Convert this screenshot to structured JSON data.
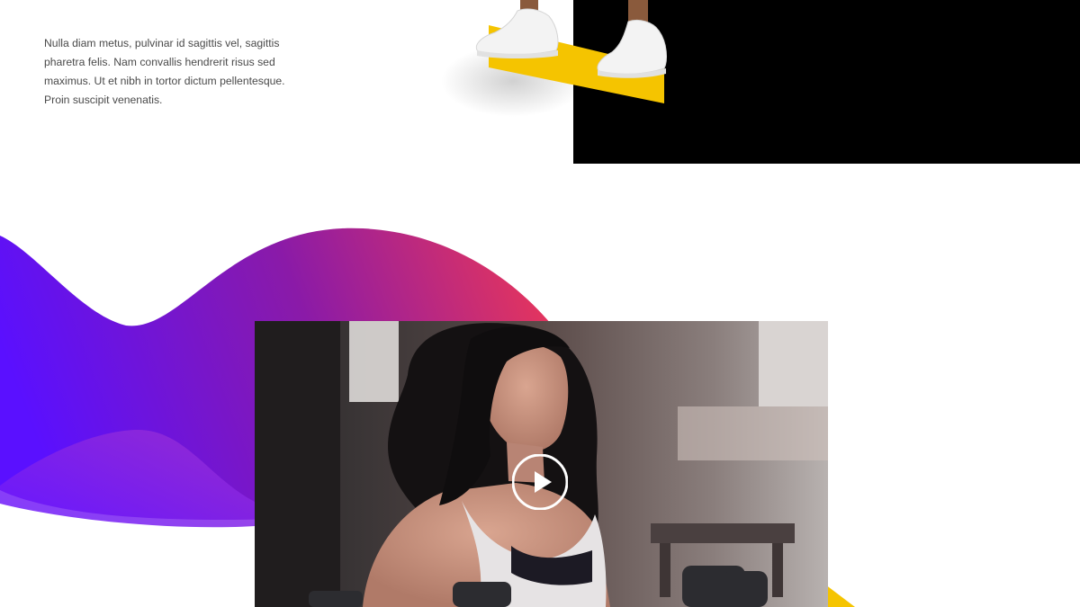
{
  "intro": {
    "body_text": "Nulla diam metus, pulvinar id sagittis vel, sagittis pharetra felis. Nam convallis hendrerit risus sed maximus. Ut et nibh in tortor dictum pellentesque. Proin suscipit venenatis."
  },
  "hero": {
    "background_color": "#000000",
    "accent_color": "#f5c400"
  },
  "wave": {
    "gradient_start": "#5a10ff",
    "gradient_end": "#e8365a"
  },
  "video": {
    "play_icon": "play-circle-icon"
  }
}
